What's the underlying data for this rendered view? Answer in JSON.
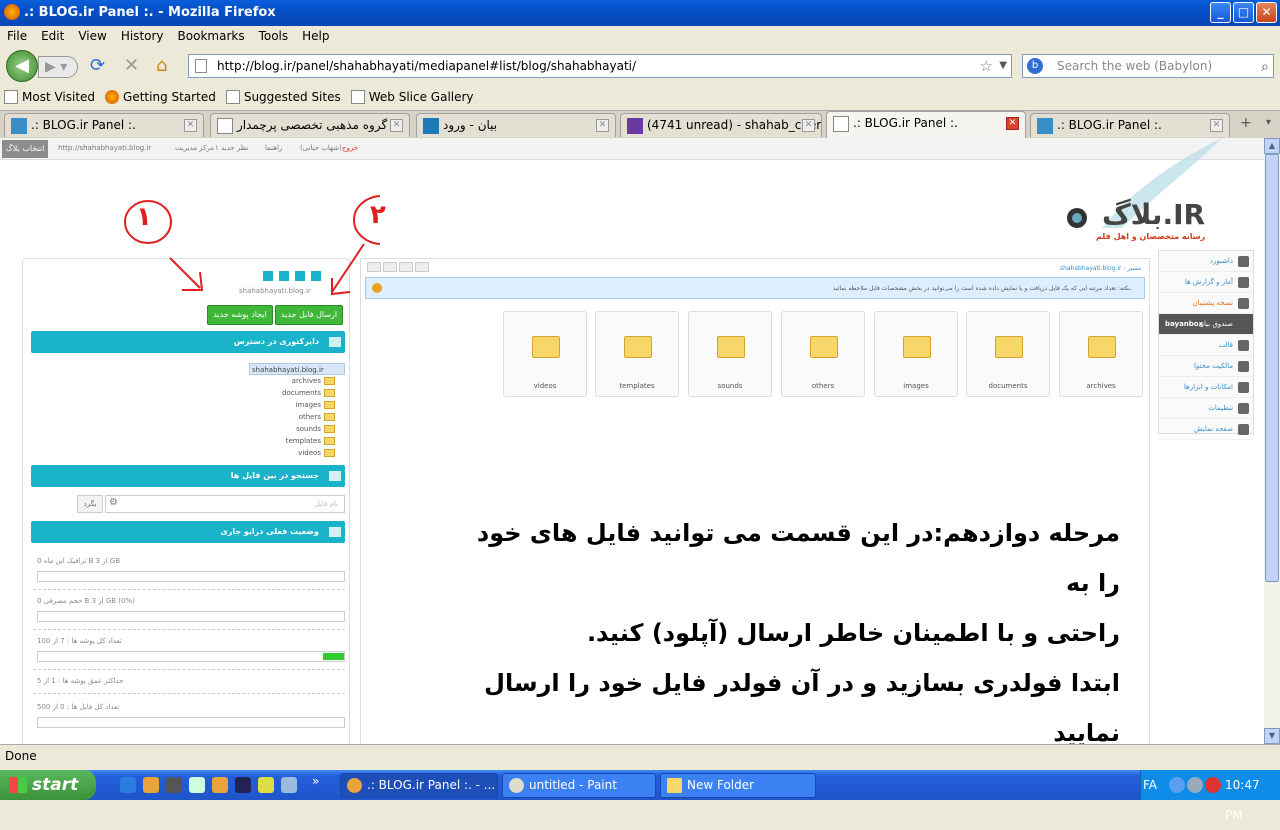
{
  "window": {
    "title": ".: BLOG.ir Panel :. - Mozilla Firefox",
    "min": "_",
    "max": "□",
    "close": "✕"
  },
  "menu": [
    "File",
    "Edit",
    "View",
    "History",
    "Bookmarks",
    "Tools",
    "Help"
  ],
  "nav": {
    "url": "http://blog.ir/panel/shahabhayati/mediapanel#list/blog/shahabhayati/",
    "search_placeholder": "Search the web (Babylon)"
  },
  "bookmarks": [
    "Most Visited",
    "Getting Started",
    "Suggested Sites",
    "Web Slice Gallery"
  ],
  "tabs": [
    ".: BLOG.ir Panel :.",
    "گروه مذهبی تخصصی پرچمدار",
    "بیان - ورود",
    "(4741 unread) - shahab_cher...",
    ".: BLOG.ir Panel :.",
    ".: BLOG.ir Panel :."
  ],
  "topnav": {
    "pick": "انتخاب بلاگ",
    "url": "http://shahabhayati.blog.ir",
    "manage": "مرکز مدیریت",
    "comments": "۱ نظر جدید",
    "guide": "راهنما",
    "user": "(شهاب حیاتی)",
    "logout": "خروج"
  },
  "logo": {
    "text": "بلاگ.IR",
    "tagline": "رسانه متخصصان و اهل قلم"
  },
  "sidebar": [
    "داشبورد",
    "آمار و گزارش ها",
    "تنظیمات",
    "صندوق بیان",
    "قالب",
    "مالکیت محتوا",
    "امکانات و ابزارها",
    "تنظیمات",
    "صفحه نمایش"
  ],
  "sidebar_labels": {
    "bayanbox": "bayanbox",
    "bayan_box": "صندوق بیان",
    "orange": "نسخه پشتیبان"
  },
  "left": {
    "site": "shahabhayati.blog.ir",
    "btn_upload": "ارسال فایل جدید",
    "btn_folder": "ایجاد پوشه جدید",
    "h_dirs": "دایرکتوری در دسترس",
    "root": "shahabhayati.blog.ir",
    "folders": [
      "archives",
      "documents",
      "images",
      "others",
      "sounds",
      "templates",
      "videos"
    ],
    "h_search": "جستجو در بین فایل ها",
    "search_placeholder": "نام فایل",
    "search_btn": "بگرد",
    "h_status": "وضعیت فعلی درایو جاری",
    "s1": "ترافیک این ماه 0 B از 3 GB",
    "s2": "حجم مصرفی 0 B از 3 GB (0%)",
    "s3": "تعداد کل پوشه ها : 7 از 100",
    "s4": "حداکثر عمق پوشه ها : 1 از 5",
    "s5": "تعداد کل فایل ها : 0 از 500",
    "folder_progress": 0.07
  },
  "main": {
    "path": "shahabhayati.blog.ir : مسیر",
    "notice": "نکته: تعداد مرتبه ایی که یک فایل دریافت و یا نمایش داده شده است را می‌توانید در بخش مشخصات فایل ملاحظه نمائید.",
    "folders": [
      "archives",
      "documents",
      "images",
      "others",
      "sounds",
      "templates",
      "videos"
    ]
  },
  "overlay": [
    "مرحله دوازدهم:در این قسمت می توانید فایل های خود را به",
    "راحتی و با اطمینان خاطر ارسال (آپلود) کنید.",
    "ابتدا فولدری بسازید و در آن فولدر فایل خود را ارسال نمایید"
  ],
  "annotations": [
    "۱",
    "۲"
  ],
  "status": "Done",
  "taskbar": {
    "start": "start",
    "tasks": [
      ".: BLOG.ir Panel :. - ...",
      "untitled - Paint",
      "New Folder"
    ],
    "lang": "FA",
    "time": "10:47 PM"
  },
  "colors": {
    "accent": "#1bb3c9",
    "green": "#3fb83a",
    "annotation": "#e02020"
  }
}
